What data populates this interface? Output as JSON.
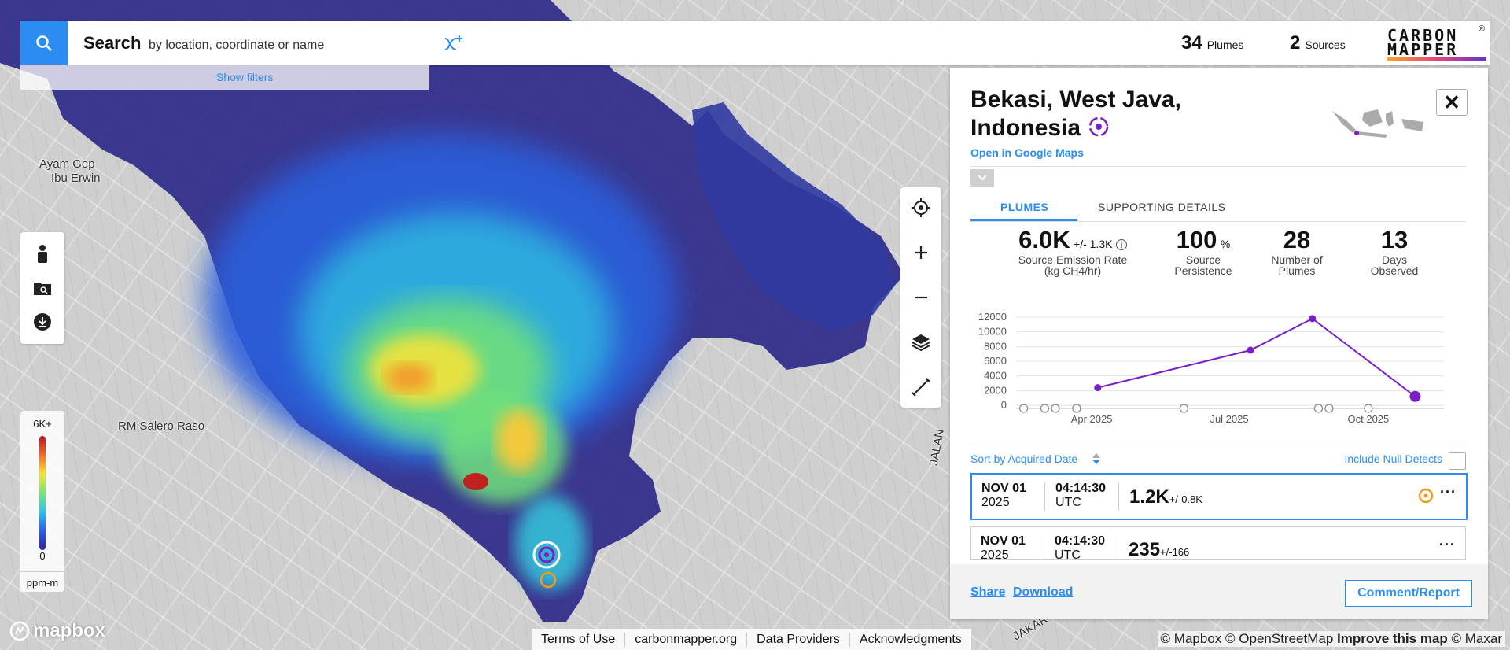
{
  "search": {
    "label": "Search",
    "hint": "by location, coordinate or name",
    "show_filters": "Show filters"
  },
  "stats": {
    "plumes_count": "34",
    "plumes_label": "Plumes",
    "sources_count": "2",
    "sources_label": "Sources"
  },
  "logo": {
    "line1": "CARBON",
    "line2": "MAPPER",
    "reg": "®"
  },
  "map_labels": {
    "place1a": "Ayam Gep",
    "place1b": "Ibu Erwin",
    "place2": "RM Salero Raso",
    "road1": "JALAN",
    "road2": "JAKARTA"
  },
  "legend": {
    "max": "6K+",
    "min": "0",
    "unit": "ppm-m"
  },
  "panel": {
    "title_line1": "Bekasi, West Java,",
    "title_line2": "Indonesia",
    "google_maps_link": "Open in Google Maps",
    "close": "✕",
    "tabs": [
      {
        "label": "PLUMES",
        "active": true
      },
      {
        "label": "SUPPORTING DETAILS",
        "active": false
      }
    ],
    "metrics": {
      "emission_value": "6.0K",
      "emission_unc": "+/- 1.3K",
      "emission_label1": "Source Emission Rate",
      "emission_label2": "(kg CH4/hr)",
      "persistence_value": "100",
      "persistence_unit": "%",
      "persistence_label1": "Source",
      "persistence_label2": "Persistence",
      "plumes_value": "28",
      "plumes_label1": "Number of",
      "plumes_label2": "Plumes",
      "days_value": "13",
      "days_label1": "Days",
      "days_label2": "Observed"
    },
    "sort": {
      "label": "Sort by Acquired Date",
      "include_null": "Include Null Detects"
    },
    "rows": [
      {
        "date": "NOV 01",
        "year": "2025",
        "time": "04:14:30",
        "tz": "UTC",
        "value": "1.2K",
        "unc": "+/-0.8K",
        "more": "···"
      },
      {
        "date": "NOV 01",
        "year": "2025",
        "time": "04:14:30",
        "tz": "UTC",
        "value": "235",
        "unc": "+/-166",
        "more": "···"
      }
    ],
    "footer": {
      "share": "Share",
      "download": "Download",
      "comment": "Comment/Report"
    }
  },
  "chart_data": {
    "type": "line",
    "ylim": [
      0,
      12000
    ],
    "yticks": [
      "12000",
      "10000",
      "8000",
      "6000",
      "4000",
      "2000",
      "0"
    ],
    "xticks": [
      "Apr 2025",
      "Jul 2025",
      "Oct 2025"
    ],
    "x": [
      "2025-02-15",
      "2025-03-01",
      "2025-03-08",
      "2025-03-22",
      "2025-04-05",
      "2025-06-01",
      "2025-07-15",
      "2025-08-25",
      "2025-08-29",
      "2025-09-05",
      "2025-10-01",
      "2025-11-01"
    ],
    "values": [
      0,
      0,
      0,
      0,
      2400,
      0,
      7500,
      11800,
      0,
      0,
      0,
      1200
    ],
    "detected": [
      false,
      false,
      false,
      false,
      true,
      false,
      true,
      true,
      false,
      false,
      false,
      true
    ],
    "series_color": "#7a1ec8"
  },
  "bottom_links": [
    "Terms of Use",
    "carbonmapper.org",
    "Data Providers",
    "Acknowledgments"
  ],
  "attribution": {
    "a1": "© Mapbox",
    "a2": "© OpenStreetMap",
    "a3": "Improve this map",
    "a4": "© Maxar"
  },
  "mapbox": "mapbox",
  "colors": {
    "accent": "#2b8cf2",
    "plume_marker": "#7a1ec8",
    "selected_marker": "#f39a1a"
  }
}
